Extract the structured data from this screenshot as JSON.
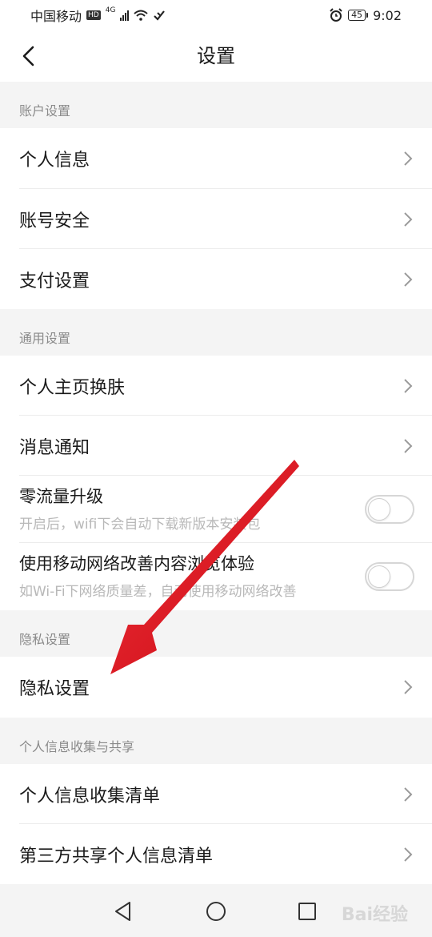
{
  "status_bar": {
    "carrier": "中国移动",
    "hd": "HD",
    "network": "4G",
    "battery": "45",
    "time": "9:02",
    "icons": [
      "signal-icon",
      "wifi-icon",
      "nfc-icon",
      "alarm-icon",
      "battery-icon"
    ]
  },
  "nav": {
    "title": "设置",
    "back_icon": "back-arrow-icon"
  },
  "sections": {
    "account": "账户设置",
    "general": "通用设置",
    "privacy": "隐私设置",
    "info_collection": "个人信息收集与共享"
  },
  "rows": {
    "personal_info": "个人信息",
    "account_security": "账号安全",
    "payment_settings": "支付设置",
    "homepage_skin": "个人主页换肤",
    "notifications": "消息通知",
    "zero_traffic": {
      "label": "零流量升级",
      "desc": "开启后，wifi下会自动下载新版本安装包",
      "enabled": false
    },
    "mobile_network": {
      "label": "使用移动网络改善内容浏览体验",
      "desc": "如Wi-Fi下网络质量差，自动使用移动网络改善",
      "enabled": false
    },
    "privacy_settings": "隐私设置",
    "info_collection_list": "个人信息收集清单",
    "third_party_list": "第三方共享个人信息清单"
  },
  "bottom_nav": {
    "icons": [
      "back-triangle-icon",
      "home-circle-icon",
      "recents-square-icon"
    ]
  },
  "watermark": "Bai经验",
  "colors": {
    "background": "#f4f4f4",
    "row": "#ffffff",
    "section_text": "#8a8a8a",
    "sub_text": "#b8b8b8",
    "annotation_arrow": "#e8141c"
  }
}
